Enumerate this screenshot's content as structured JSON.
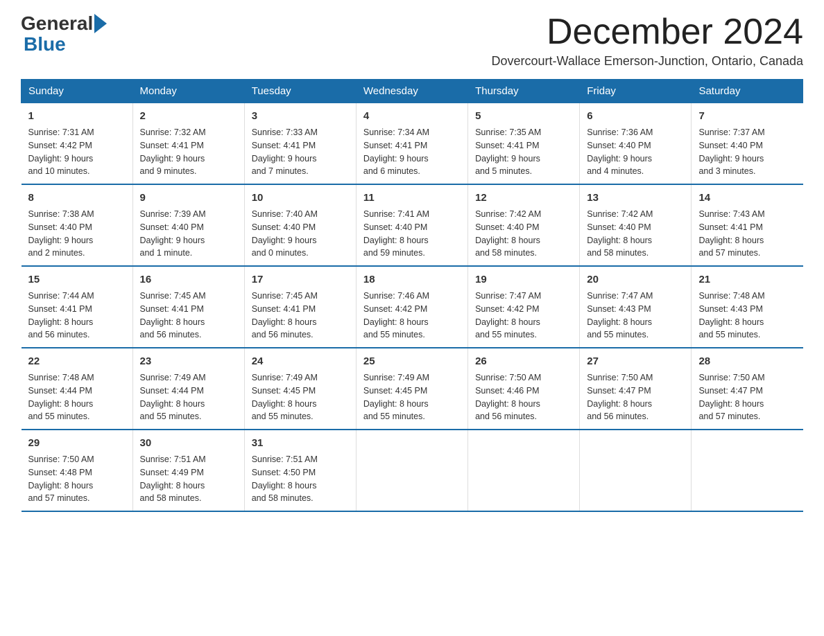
{
  "logo": {
    "general": "General",
    "blue": "Blue"
  },
  "header": {
    "month": "December 2024",
    "location": "Dovercourt-Wallace Emerson-Junction, Ontario, Canada"
  },
  "days_of_week": [
    "Sunday",
    "Monday",
    "Tuesday",
    "Wednesday",
    "Thursday",
    "Friday",
    "Saturday"
  ],
  "weeks": [
    [
      {
        "num": "1",
        "sunrise": "7:31 AM",
        "sunset": "4:42 PM",
        "daylight": "9 hours and 10 minutes."
      },
      {
        "num": "2",
        "sunrise": "7:32 AM",
        "sunset": "4:41 PM",
        "daylight": "9 hours and 9 minutes."
      },
      {
        "num": "3",
        "sunrise": "7:33 AM",
        "sunset": "4:41 PM",
        "daylight": "9 hours and 7 minutes."
      },
      {
        "num": "4",
        "sunrise": "7:34 AM",
        "sunset": "4:41 PM",
        "daylight": "9 hours and 6 minutes."
      },
      {
        "num": "5",
        "sunrise": "7:35 AM",
        "sunset": "4:41 PM",
        "daylight": "9 hours and 5 minutes."
      },
      {
        "num": "6",
        "sunrise": "7:36 AM",
        "sunset": "4:40 PM",
        "daylight": "9 hours and 4 minutes."
      },
      {
        "num": "7",
        "sunrise": "7:37 AM",
        "sunset": "4:40 PM",
        "daylight": "9 hours and 3 minutes."
      }
    ],
    [
      {
        "num": "8",
        "sunrise": "7:38 AM",
        "sunset": "4:40 PM",
        "daylight": "9 hours and 2 minutes."
      },
      {
        "num": "9",
        "sunrise": "7:39 AM",
        "sunset": "4:40 PM",
        "daylight": "9 hours and 1 minute."
      },
      {
        "num": "10",
        "sunrise": "7:40 AM",
        "sunset": "4:40 PM",
        "daylight": "9 hours and 0 minutes."
      },
      {
        "num": "11",
        "sunrise": "7:41 AM",
        "sunset": "4:40 PM",
        "daylight": "8 hours and 59 minutes."
      },
      {
        "num": "12",
        "sunrise": "7:42 AM",
        "sunset": "4:40 PM",
        "daylight": "8 hours and 58 minutes."
      },
      {
        "num": "13",
        "sunrise": "7:42 AM",
        "sunset": "4:40 PM",
        "daylight": "8 hours and 58 minutes."
      },
      {
        "num": "14",
        "sunrise": "7:43 AM",
        "sunset": "4:41 PM",
        "daylight": "8 hours and 57 minutes."
      }
    ],
    [
      {
        "num": "15",
        "sunrise": "7:44 AM",
        "sunset": "4:41 PM",
        "daylight": "8 hours and 56 minutes."
      },
      {
        "num": "16",
        "sunrise": "7:45 AM",
        "sunset": "4:41 PM",
        "daylight": "8 hours and 56 minutes."
      },
      {
        "num": "17",
        "sunrise": "7:45 AM",
        "sunset": "4:41 PM",
        "daylight": "8 hours and 56 minutes."
      },
      {
        "num": "18",
        "sunrise": "7:46 AM",
        "sunset": "4:42 PM",
        "daylight": "8 hours and 55 minutes."
      },
      {
        "num": "19",
        "sunrise": "7:47 AM",
        "sunset": "4:42 PM",
        "daylight": "8 hours and 55 minutes."
      },
      {
        "num": "20",
        "sunrise": "7:47 AM",
        "sunset": "4:43 PM",
        "daylight": "8 hours and 55 minutes."
      },
      {
        "num": "21",
        "sunrise": "7:48 AM",
        "sunset": "4:43 PM",
        "daylight": "8 hours and 55 minutes."
      }
    ],
    [
      {
        "num": "22",
        "sunrise": "7:48 AM",
        "sunset": "4:44 PM",
        "daylight": "8 hours and 55 minutes."
      },
      {
        "num": "23",
        "sunrise": "7:49 AM",
        "sunset": "4:44 PM",
        "daylight": "8 hours and 55 minutes."
      },
      {
        "num": "24",
        "sunrise": "7:49 AM",
        "sunset": "4:45 PM",
        "daylight": "8 hours and 55 minutes."
      },
      {
        "num": "25",
        "sunrise": "7:49 AM",
        "sunset": "4:45 PM",
        "daylight": "8 hours and 55 minutes."
      },
      {
        "num": "26",
        "sunrise": "7:50 AM",
        "sunset": "4:46 PM",
        "daylight": "8 hours and 56 minutes."
      },
      {
        "num": "27",
        "sunrise": "7:50 AM",
        "sunset": "4:47 PM",
        "daylight": "8 hours and 56 minutes."
      },
      {
        "num": "28",
        "sunrise": "7:50 AM",
        "sunset": "4:47 PM",
        "daylight": "8 hours and 57 minutes."
      }
    ],
    [
      {
        "num": "29",
        "sunrise": "7:50 AM",
        "sunset": "4:48 PM",
        "daylight": "8 hours and 57 minutes."
      },
      {
        "num": "30",
        "sunrise": "7:51 AM",
        "sunset": "4:49 PM",
        "daylight": "8 hours and 58 minutes."
      },
      {
        "num": "31",
        "sunrise": "7:51 AM",
        "sunset": "4:50 PM",
        "daylight": "8 hours and 58 minutes."
      },
      null,
      null,
      null,
      null
    ]
  ],
  "labels": {
    "sunrise": "Sunrise:",
    "sunset": "Sunset:",
    "daylight": "Daylight:"
  }
}
